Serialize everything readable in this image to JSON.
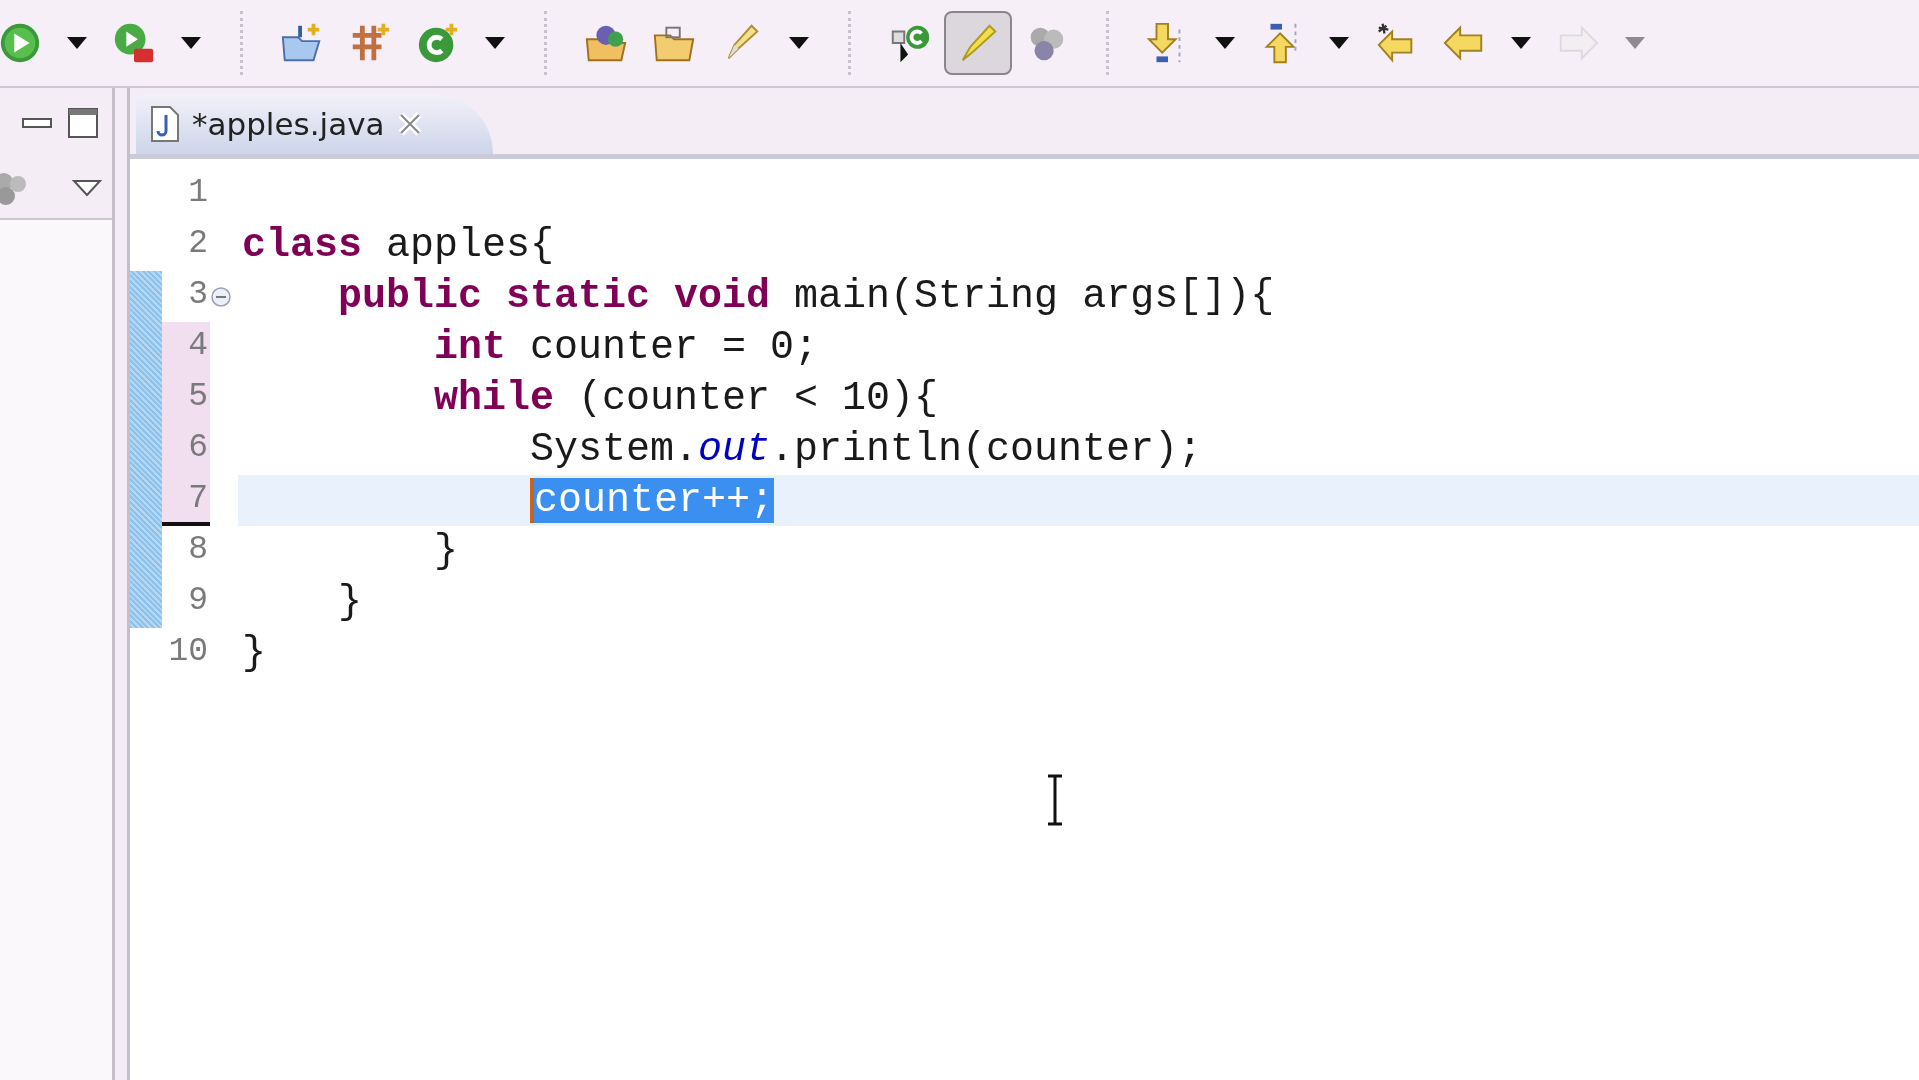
{
  "toolbar": [
    {
      "kind": "button",
      "pressed": false,
      "disabled": false
    },
    {
      "kind": "dropdown",
      "disabled": false
    },
    {
      "kind": "button",
      "pressed": false,
      "disabled": false
    },
    {
      "kind": "dropdown",
      "disabled": false
    },
    {
      "kind": "separator"
    },
    {
      "kind": "button",
      "pressed": false,
      "disabled": false
    },
    {
      "kind": "button",
      "pressed": false,
      "disabled": false
    },
    {
      "kind": "button",
      "pressed": false,
      "disabled": false
    },
    {
      "kind": "dropdown",
      "disabled": false
    },
    {
      "kind": "separator"
    },
    {
      "kind": "button",
      "pressed": false,
      "disabled": false
    },
    {
      "kind": "button",
      "pressed": false,
      "disabled": false
    },
    {
      "kind": "button",
      "pressed": false,
      "disabled": false
    },
    {
      "kind": "dropdown",
      "disabled": false
    },
    {
      "kind": "separator"
    },
    {
      "kind": "button",
      "pressed": false,
      "disabled": false
    },
    {
      "kind": "button",
      "pressed": true,
      "disabled": false
    },
    {
      "kind": "button",
      "pressed": false,
      "disabled": false
    },
    {
      "kind": "separator"
    },
    {
      "kind": "button",
      "pressed": false,
      "disabled": false
    },
    {
      "kind": "dropdown",
      "disabled": false
    },
    {
      "kind": "button",
      "pressed": false,
      "disabled": false
    },
    {
      "kind": "dropdown",
      "disabled": false
    },
    {
      "kind": "button",
      "pressed": false,
      "disabled": false
    },
    {
      "kind": "button",
      "pressed": false,
      "disabled": false
    },
    {
      "kind": "dropdown",
      "disabled": false
    },
    {
      "kind": "button",
      "pressed": false,
      "disabled": true
    },
    {
      "kind": "dropdown",
      "disabled": true
    }
  ],
  "editor": {
    "tabs": [
      {
        "label": "*apples.java",
        "selected": true
      }
    ],
    "lines": [
      {
        "n": "1",
        "current": false,
        "foldable": false,
        "changed": false,
        "in_range": false
      },
      {
        "n": "2",
        "tokens": [
          {
            "kind": "keyword",
            "text": "class"
          },
          {
            "kind": "plain",
            "text": " apples{"
          }
        ],
        "current": false,
        "foldable": false,
        "changed": false,
        "in_range": false,
        "children": [
          {
            "n": "3",
            "tokens": [
              {
                "kind": "keyword",
                "text": "public static void"
              },
              {
                "kind": "plain",
                "text": " main(String args[]){"
              }
            ],
            "current": false,
            "foldable": true,
            "changed": true,
            "in_range": false,
            "children": [
              {
                "n": "4",
                "tokens": [
                  {
                    "kind": "keyword",
                    "text": "int"
                  },
                  {
                    "kind": "plain",
                    "text": " counter = 0;"
                  }
                ],
                "current": false,
                "foldable": false,
                "changed": true,
                "in_range": true
              },
              {
                "n": "5",
                "tokens": [
                  {
                    "kind": "keyword",
                    "text": "while"
                  },
                  {
                    "kind": "plain",
                    "text": " (counter < 10){"
                  }
                ],
                "current": false,
                "foldable": false,
                "changed": true,
                "in_range": true,
                "children": [
                  {
                    "n": "6",
                    "tokens": [
                      {
                        "kind": "plain",
                        "text": "System."
                      },
                      {
                        "kind": "field",
                        "text": "out"
                      },
                      {
                        "kind": "plain",
                        "text": ".println(counter);"
                      }
                    ],
                    "current": false,
                    "foldable": false,
                    "changed": true,
                    "in_range": true
                  },
                  {
                    "n": "7",
                    "tokens": [
                      {
                        "kind": "selection",
                        "text": "counter++;"
                      }
                    ],
                    "current": true,
                    "foldable": false,
                    "changed": true,
                    "in_range": true
                  }
                ]
              },
              {
                "n": "8",
                "tokens": [
                  {
                    "kind": "plain",
                    "text": "}"
                  }
                ],
                "current": false,
                "foldable": false,
                "changed": true,
                "in_range": false
              }
            ]
          },
          {
            "n": "9",
            "tokens": [
              {
                "kind": "plain",
                "text": "}"
              }
            ],
            "current": false,
            "foldable": false,
            "changed": true,
            "in_range": false
          }
        ]
      },
      {
        "n": "10",
        "tokens": [
          {
            "kind": "plain",
            "text": "}"
          }
        ],
        "current": false,
        "foldable": false,
        "changed": false,
        "in_range": false
      }
    ]
  }
}
